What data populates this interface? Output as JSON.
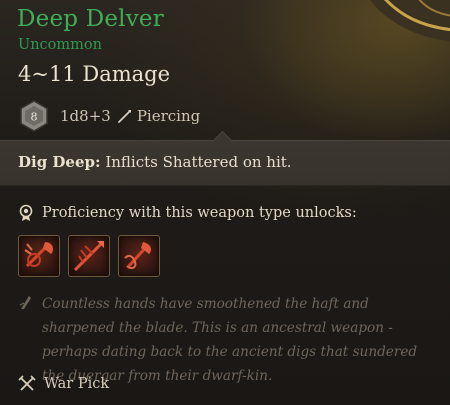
{
  "item": {
    "name": "Deep Delver",
    "rarity": "Uncommon",
    "damage": "4~11 Damage",
    "die_label": "8",
    "roll": "1d8+3",
    "damage_type": "Piercing",
    "ability_name": "Dig Deep:",
    "ability_text": " Inflicts Shattered on hit.",
    "proficiency_text": "Proficiency with this weapon type unlocks:",
    "actions": [
      {
        "icon": "brutal-cleave-icon"
      },
      {
        "icon": "piercing-strike-icon"
      },
      {
        "icon": "rush-attack-icon"
      }
    ],
    "flavor": "Countless hands have smoothened the haft and sharpened the blade. This is an ancestral weapon - perhaps dating back to the ancient digs that sundered the duergar from their dwarf-kin.",
    "weapon_type": "War Pick"
  },
  "colors": {
    "name": "#3eae58",
    "rarity": "#2f9a50",
    "flavor": "#6f665a",
    "band": "#3b3630",
    "action_red": "#c23a22"
  }
}
